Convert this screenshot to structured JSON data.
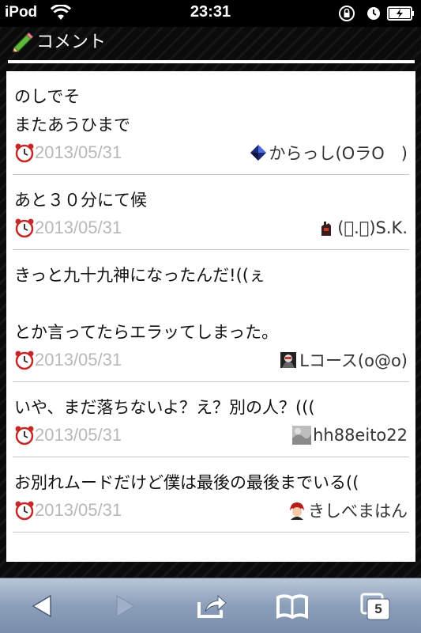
{
  "status_bar": {
    "carrier": "iPod",
    "time": "23:31"
  },
  "section": {
    "title": "コメント"
  },
  "comments": [
    {
      "lines": [
        "のしでそ",
        "またあうひまで"
      ],
      "date": "2013/05/31",
      "author": "からっし(OラO　)"
    },
    {
      "lines": [
        "あと３０分にて候"
      ],
      "date": "2013/05/31",
      "author": "(ﾟ.ﾟ)S.K."
    },
    {
      "lines": [
        "きっと九十九神になったんだ!((ぇ",
        "",
        "とか言ってたらエラッてしまった。"
      ],
      "date": "2013/05/31",
      "author": "Lコース(o@o)"
    },
    {
      "lines": [
        "いや、まだ落ちないよ？え？別の人？((("
      ],
      "date": "2013/05/31",
      "author": "hh88eito22"
    },
    {
      "lines": [
        "お別れムードだけど僕は最後の最後までいる(("
      ],
      "date": "2013/05/31",
      "author": "きしべまはん"
    }
  ],
  "toolbar": {
    "tabs_count": "5"
  },
  "colors": {
    "accent_toolbar": "#8c9fb9",
    "date_text": "#b8b8b8"
  }
}
